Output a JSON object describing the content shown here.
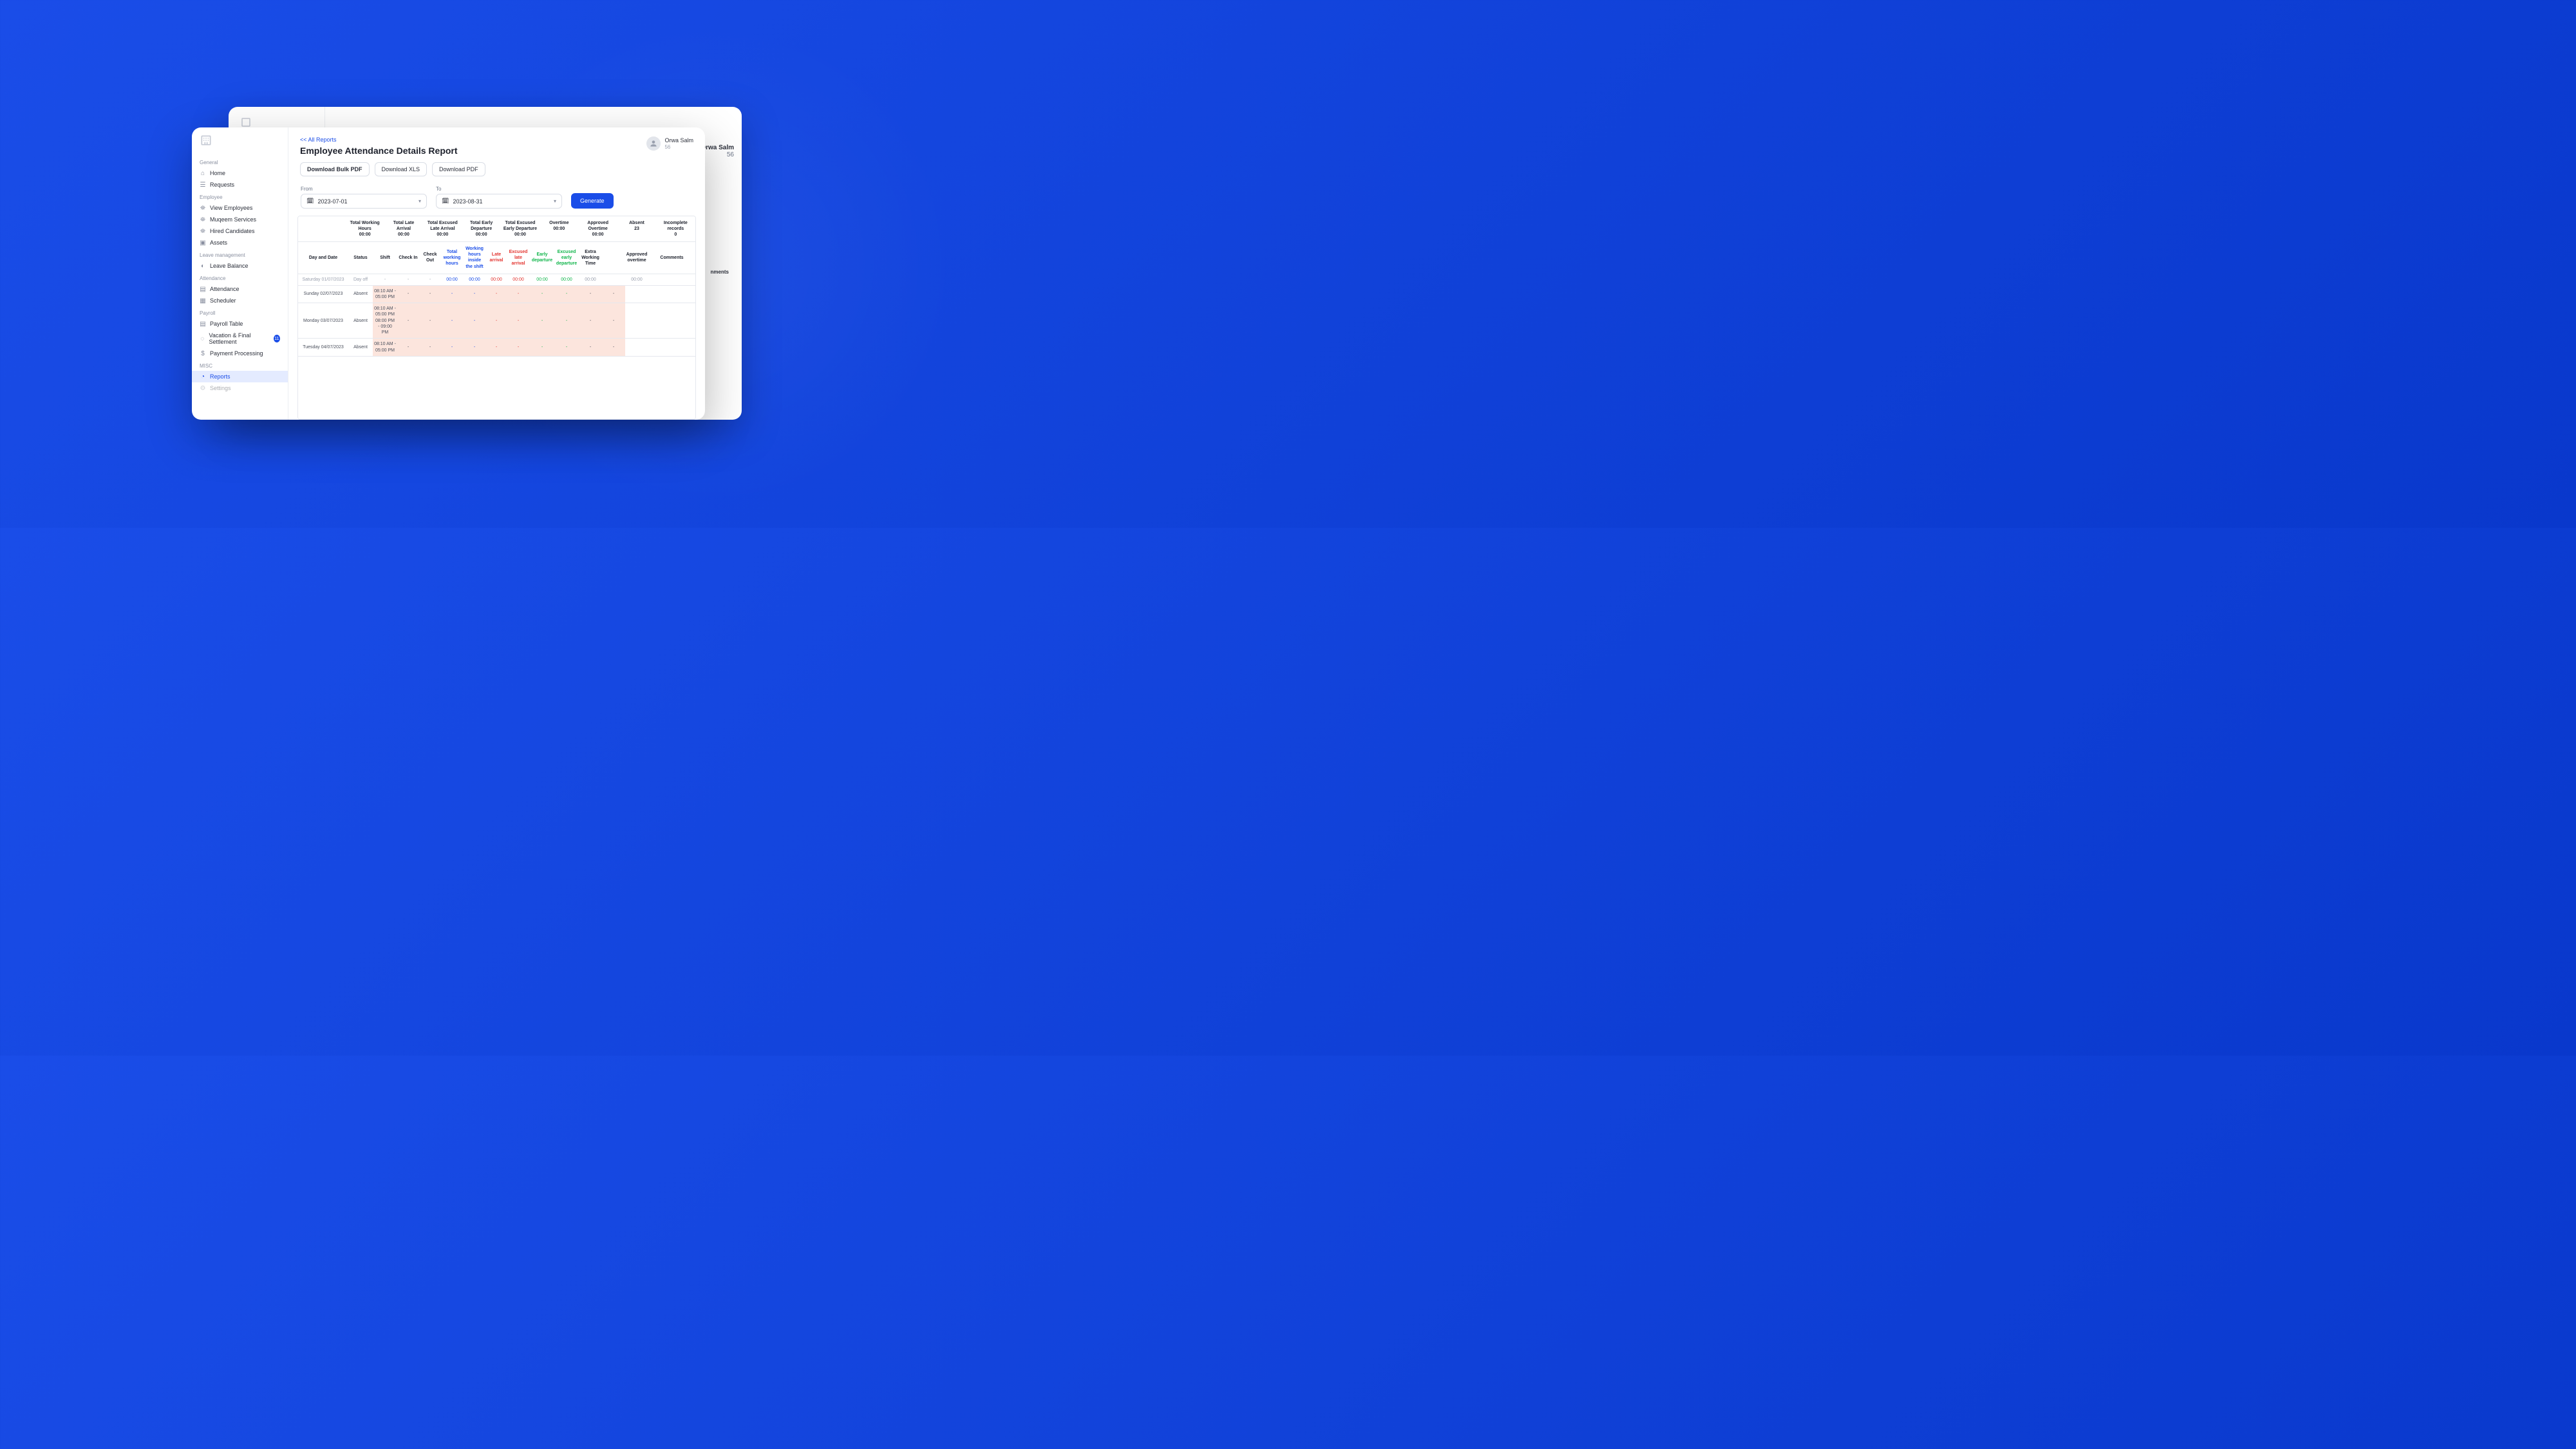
{
  "back_window": {
    "user_name": "Orwa Salm",
    "user_sub": "56",
    "col_peek": "nments"
  },
  "sidebar": {
    "sections": [
      {
        "title": "General",
        "items": [
          {
            "label": "Home",
            "icon": "⌂"
          },
          {
            "label": "Requests",
            "icon": "☰"
          }
        ]
      },
      {
        "title": "Employee",
        "items": [
          {
            "label": "View Employees",
            "icon": "⛯"
          },
          {
            "label": "Muqeem Services",
            "icon": "⛯"
          },
          {
            "label": "Hired Candidates",
            "icon": "⛯"
          },
          {
            "label": "Assets",
            "icon": "▣"
          }
        ]
      },
      {
        "title": "Leave management",
        "items": [
          {
            "label": "Leave Balance",
            "icon": "◐"
          }
        ]
      },
      {
        "title": "Attendance",
        "items": [
          {
            "label": "Attendance",
            "icon": "▤"
          },
          {
            "label": "Scheduler",
            "icon": "▦"
          }
        ]
      },
      {
        "title": "Payroll",
        "items": [
          {
            "label": "Payroll Table",
            "icon": "▤"
          },
          {
            "label": "Vacation & Final Settlement",
            "icon": "◌",
            "badge": "11"
          },
          {
            "label": "Payment Processing",
            "icon": "$"
          }
        ]
      },
      {
        "title": "MISC",
        "items": [
          {
            "label": "Reports",
            "icon": "◔",
            "active": true
          },
          {
            "label": "Settings",
            "icon": ""
          }
        ]
      }
    ]
  },
  "header": {
    "breadcrumb": "<< All Reports",
    "title": "Employee Attendance Details Report",
    "user_name": "Orwa Salm",
    "user_sub": "56"
  },
  "actions": {
    "download_bulk_pdf": "Download Bulk PDF",
    "download_xls": "Download XLS",
    "download_pdf": "Download PDF"
  },
  "filters": {
    "from_label": "From",
    "to_label": "To",
    "from_value": "2023-07-01",
    "to_value": "2023-08-31",
    "generate_label": "Generate"
  },
  "summary": {
    "total_working_hours": {
      "label": "Total Working Hours",
      "value": "00:00"
    },
    "total_late_arrival": {
      "label": "Total Late Arrival",
      "value": "00:00"
    },
    "total_excused_late_arrival": {
      "label": "Total Excused Late Arrival",
      "value": "00:00"
    },
    "total_early_departure": {
      "label": "Total Early Departure",
      "value": "00:00"
    },
    "total_excused_early_departure": {
      "label": "Total Excused Early Departure",
      "value": "00:00"
    },
    "overtime": {
      "label": "Overtime",
      "value": "00:00"
    },
    "approved_overtime": {
      "label": "Approved Overtime",
      "value": "00:00"
    },
    "absent": {
      "label": "Absent",
      "value": "23"
    },
    "incomplete_records": {
      "label": "Incomplete records",
      "value": "0"
    }
  },
  "columns": {
    "day_date": "Day and Date",
    "status": "Status",
    "shift": "Shift",
    "check_in": "Check In",
    "check_out": "Check Out",
    "total_working_hours": "Total working hours",
    "working_hours_inside_shift": "Working hours inside the shift",
    "late_arrival": "Late arrival",
    "excused_late_arrival": "Excused late arrival",
    "early_departure": "Early departure",
    "excused_early_departure": "Excused early departure",
    "extra_working_time": "Extra Working Time",
    "approved_overtime": "Approved overtime",
    "comments": "Comments"
  },
  "rows": [
    {
      "day": "Saturday 01/07/2023",
      "status": "Day off",
      "type": "dayoff",
      "shift": "-",
      "in": "-",
      "out": "-",
      "twh": "00:00",
      "whi": "00:00",
      "la": "00:00",
      "ela": "00:00",
      "ed": "00:00",
      "eed": "00:00",
      "ewt": "00:00",
      "ao": "",
      "ao2": "00:00",
      "com": ""
    },
    {
      "day": "Sunday 02/07/2023",
      "status": "Absent",
      "type": "absent",
      "shift": "08:10 AM - 05:00 PM",
      "in": "-",
      "out": "-",
      "twh": "-",
      "whi": "-",
      "la": "-",
      "ela": "-",
      "ed": "-",
      "eed": "-",
      "ewt": "-",
      "ao": "-",
      "ao2": "",
      "com": ""
    },
    {
      "day": "Monday 03/07/2023",
      "status": "Absent",
      "type": "absent",
      "shift2": true,
      "shift_a": "08:10 AM - 05:00 PM",
      "shift_b": "08:00 PM - 09:00 PM",
      "in": "-",
      "out": "-",
      "twh": "-",
      "whi": "-",
      "la": "-",
      "ela": "-",
      "ed": "-",
      "eed": "-",
      "ewt": "-",
      "ao": "-",
      "ao2": "",
      "com": ""
    },
    {
      "day": "Tuesday 04/07/2023",
      "status": "Absent",
      "type": "absent",
      "shift": "08:10 AM - 05:00 PM",
      "in": "-",
      "out": "-",
      "twh": "-",
      "whi": "-",
      "la": "-",
      "ela": "-",
      "ed": "-",
      "eed": "-",
      "ewt": "-",
      "ao": "-",
      "ao2": "",
      "com": ""
    }
  ]
}
